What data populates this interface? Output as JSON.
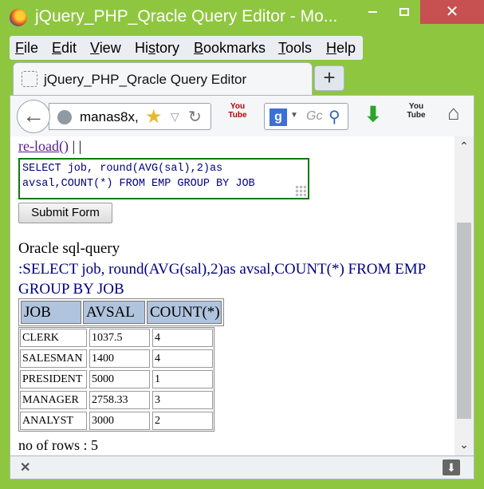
{
  "window": {
    "title": "jQuery_PHP_Qracle Query Editor - Mo...",
    "minimize_glyph": "",
    "close_glyph": "✕"
  },
  "menu": [
    {
      "label": "File",
      "accel": "F",
      "rest": "ile"
    },
    {
      "label": "Edit",
      "accel": "E",
      "rest": "dit"
    },
    {
      "label": "View",
      "accel": "V",
      "rest": "iew"
    },
    {
      "label": "History",
      "accel": "s",
      "pre": "Hi",
      "rest": "tory"
    },
    {
      "label": "Bookmarks",
      "accel": "B",
      "rest": "ookmarks"
    },
    {
      "label": "Tools",
      "accel": "T",
      "rest": "ools"
    },
    {
      "label": "Help",
      "accel": "H",
      "rest": "elp"
    }
  ],
  "tab": {
    "label": "jQuery_PHP_Qracle Query Editor",
    "new_tab_label": "+"
  },
  "navbar": {
    "url": "manas8x,",
    "search_placeholder": "Gc",
    "search_engine": "g",
    "youtube_label_1": "You Tube",
    "youtube_label_2": "You Tube"
  },
  "content": {
    "reload_link": "re-load()",
    "separators": " | |",
    "sql_text": "SELECT job, round(AVG(sal),2)as avsal,COUNT(*) FROM EMP GROUP BY JOB",
    "submit_label": "Submit Form",
    "oracle_label": "Oracle sql-query",
    "query_echo": ":SELECT job, round(AVG(sal),2)as avsal,COUNT(*) FROM EMP GROUP BY JOB",
    "table_headers": [
      "JOB",
      "AVSAL",
      "COUNT(*)"
    ],
    "table_rows": [
      [
        "CLERK",
        "1037.5",
        "4"
      ],
      [
        "SALESMAN",
        "1400",
        "4"
      ],
      [
        "PRESIDENT",
        "5000",
        "1"
      ],
      [
        "MANAGER",
        "2758.33",
        "3"
      ],
      [
        "ANALYST",
        "3000",
        "2"
      ]
    ],
    "rows_count": "no of rows : 5"
  },
  "addon_bar": {
    "close_glyph": "✕",
    "download_glyph": "⬇"
  },
  "colors": {
    "chrome": "#8ec63f",
    "close_button": "#c75050",
    "header_cell": "#b0c4de",
    "sql_border": "#0b7a0b",
    "query_text": "#000080"
  }
}
